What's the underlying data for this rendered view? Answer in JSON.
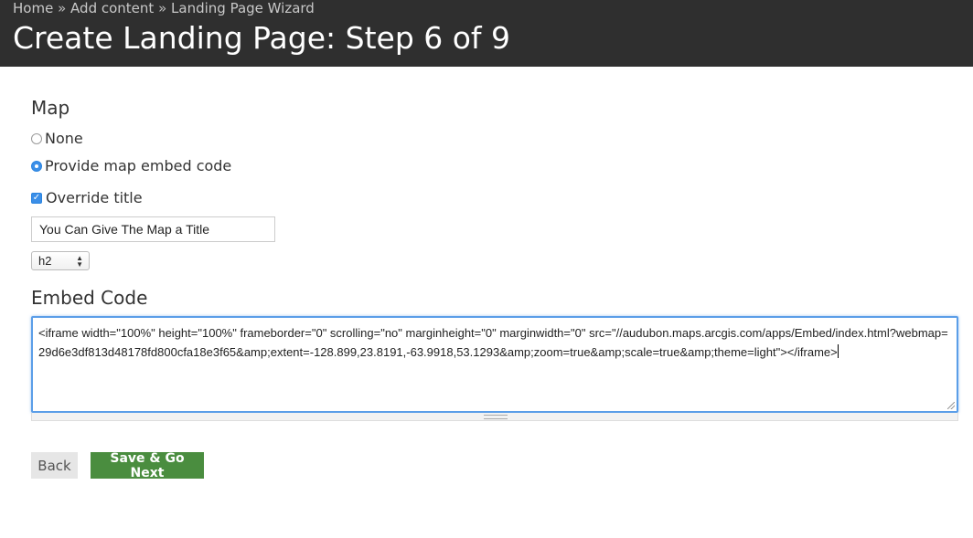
{
  "breadcrumb": {
    "items": [
      "Home",
      "Add content",
      "Landing Page Wizard"
    ],
    "separator": "»"
  },
  "page": {
    "title": "Create Landing Page: Step 6 of 9"
  },
  "map_section": {
    "label": "Map",
    "options": [
      {
        "label": "None",
        "selected": false
      },
      {
        "label": "Provide map embed code",
        "selected": true
      }
    ],
    "override_title": {
      "label": "Override title",
      "checked": true
    },
    "title_value": "You Can Give The Map a Title",
    "heading_level": "h2"
  },
  "embed_section": {
    "label": "Embed Code",
    "code": "<iframe width=\"100%\" height=\"100%\" frameborder=\"0\" scrolling=\"no\" marginheight=\"0\" marginwidth=\"0\" src=\"//audubon.maps.arcgis.com/apps/Embed/index.html?webmap=29d6e3df813d48178fd800cfa18e3f65&amp;extent=-128.899,23.8191,-63.9918,53.1293&amp;zoom=true&amp;scale=true&amp;theme=light\"></iframe>"
  },
  "buttons": {
    "back": "Back",
    "next": "Save & Go Next"
  },
  "colors": {
    "header_bg": "#2f2f2f",
    "accent": "#3b8fe8",
    "primary_button": "#4a8d3f"
  }
}
